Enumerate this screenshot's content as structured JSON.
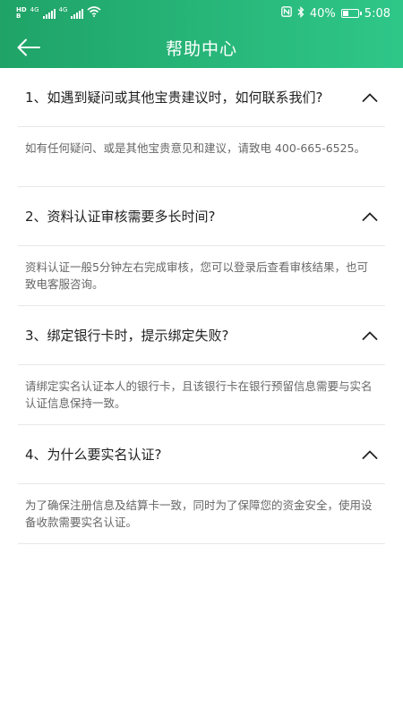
{
  "status_bar": {
    "hd1": "HD",
    "hd_sub": "B",
    "net1": "4G",
    "net2": "4G",
    "battery_pct": "40%",
    "battery_level": 0.4,
    "time": "5:08"
  },
  "header": {
    "title": "帮助中心"
  },
  "faq": [
    {
      "question": "1、如遇到疑问或其他宝贵建议时，如何联系我们?",
      "answer": "如有任何疑问、或是其他宝贵意见和建议，请致电 400-665-6525。"
    },
    {
      "question": "2、资料认证审核需要多长时间?",
      "answer": "资料认证一般5分钟左右完成审核，您可以登录后查看审核结果，也可致电客服咨询。"
    },
    {
      "question": "3、绑定银行卡时，提示绑定失败?",
      "answer": "请绑定实名认证本人的银行卡，且该银行卡在银行预留信息需要与实名认证信息保持一致。"
    },
    {
      "question": "4、为什么要实名认证?",
      "answer": "为了确保注册信息及结算卡一致，同时为了保障您的资金安全，使用设备收款需要实名认证。"
    }
  ]
}
